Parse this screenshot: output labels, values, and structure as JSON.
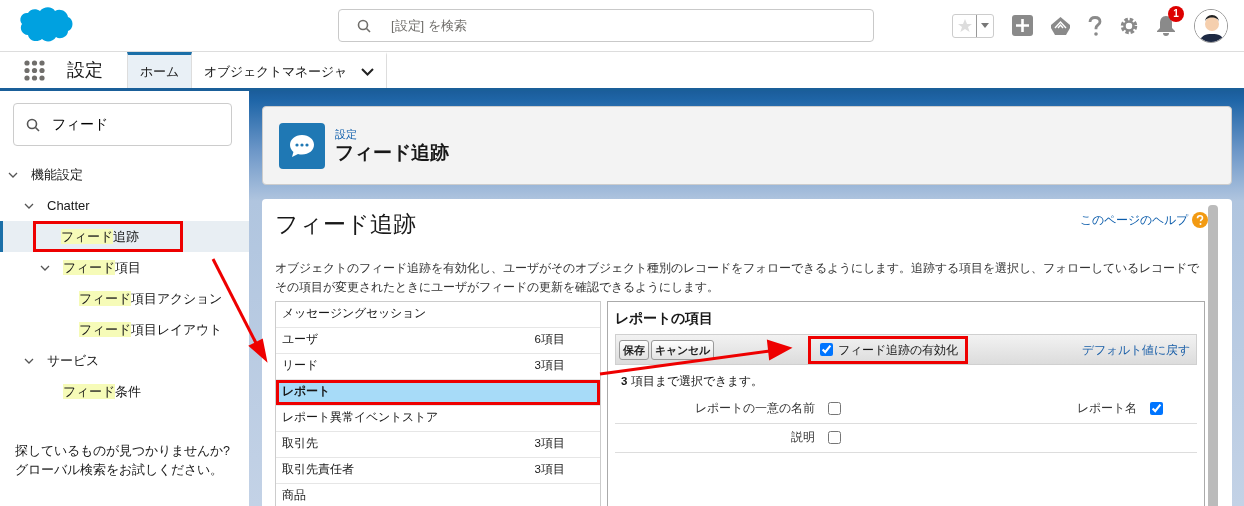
{
  "header": {
    "search": {
      "placeholder": "[設定] を検索"
    },
    "notification_count": "1"
  },
  "nav": {
    "app_name": "設定",
    "tabs": [
      {
        "label": "ホーム",
        "selected": true,
        "dropdown": false
      },
      {
        "label": "オブジェクトマネージャ",
        "selected": false,
        "dropdown": true
      }
    ]
  },
  "sidebar": {
    "search": {
      "value": "フィード"
    },
    "tree": [
      {
        "label": "機能設定",
        "expanded": true,
        "selected": false,
        "annotated": false,
        "children": [
          {
            "label": "Chatter",
            "expanded": true,
            "selected": false,
            "annotated": false,
            "children": [
              {
                "match": "フィード",
                "rest": "追跡",
                "selected": true,
                "annotated": true
              },
              {
                "match": "フィード",
                "rest": "項目",
                "expanded": true,
                "selected": false,
                "annotated": false,
                "children": [
                  {
                    "match": "フィード",
                    "rest": "項目アクション",
                    "selected": false,
                    "annotated": false
                  },
                  {
                    "match": "フィード",
                    "rest": "項目レイアウト",
                    "selected": false,
                    "annotated": false
                  }
                ]
              }
            ]
          },
          {
            "label": "サービス",
            "expanded": true,
            "selected": false,
            "annotated": false,
            "children": [
              {
                "match": "フィード",
                "rest": "条件",
                "selected": false,
                "annotated": false
              }
            ]
          }
        ]
      }
    ],
    "help_text": [
      "探しているものが見つかりませんか?",
      "グローバル検索をお試しください。"
    ]
  },
  "page_header": {
    "breadcrumb": "設定",
    "title": "フィード追跡"
  },
  "content": {
    "title": "フィード追跡",
    "help_link": "このページのヘルプ",
    "description": "オブジェクトのフィード追跡を有効化し、ユーザがそのオブジェクト種別のレコードをフォローできるようにします。追跡する項目を選択し、フォローしているレコードでその項目が変更されたときにユーザがフィードの更新を確認できるようにします。",
    "objects": [
      {
        "name": "メッセージングセッション",
        "selected": false,
        "annotated": false
      },
      {
        "name": "ユーザ",
        "count": "6項目",
        "selected": false,
        "annotated": false
      },
      {
        "name": "リード",
        "count": "3項目",
        "selected": false,
        "annotated": false
      },
      {
        "name": "レポート",
        "selected": true,
        "annotated": true
      },
      {
        "name": "レポート異常イベントストア",
        "selected": false,
        "annotated": false
      },
      {
        "name": "取引先",
        "count": "3項目",
        "selected": false,
        "annotated": false
      },
      {
        "name": "取引先責任者",
        "count": "3項目",
        "selected": false,
        "annotated": false
      },
      {
        "name": "商品",
        "selected": false,
        "annotated": false
      }
    ],
    "fields_panel": {
      "title": "レポートの項目",
      "buttons": [
        "保存",
        "キャンセル"
      ],
      "enable": {
        "label": "フィード追跡の有効化",
        "checked": true,
        "annotated": true
      },
      "reset_link": "デフォルト値に戻す",
      "limit_note": "**3** 項目まで選択できます。",
      "fields": [
        {
          "label": "レポートの一意の名前",
          "checked": false
        },
        {
          "label": "レポート名",
          "checked": true
        },
        {
          "label": "説明",
          "checked": false
        }
      ]
    }
  }
}
